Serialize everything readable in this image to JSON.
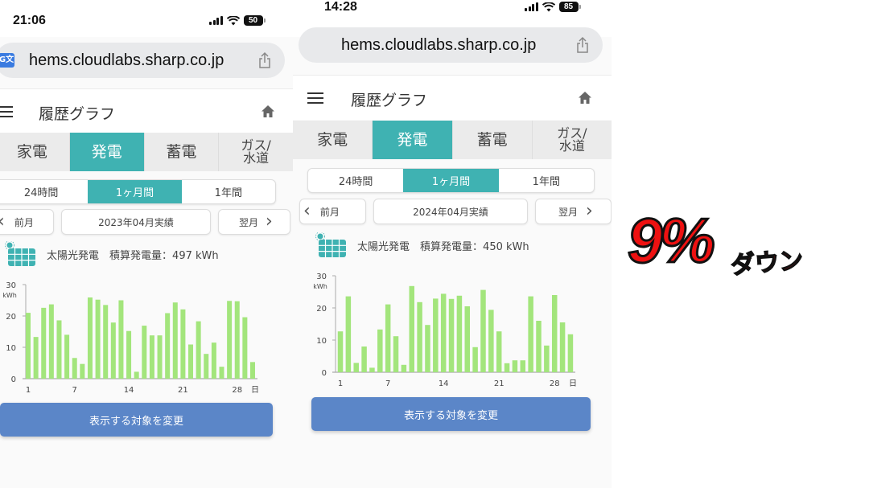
{
  "phones": [
    {
      "status": {
        "time": "21:06",
        "battery": "50"
      },
      "browser": {
        "url": "hems.cloudlabs.sharp.co.jp",
        "translate_icon": "translate-icon",
        "share_icon": "share-icon"
      },
      "header": {
        "title": "履歴グラフ",
        "menu_icon": "hamburger-icon",
        "home_icon": "home-icon"
      },
      "category_tabs": [
        {
          "label": "家電",
          "active": false
        },
        {
          "label": "発電",
          "active": true
        },
        {
          "label": "蓄電",
          "active": false
        },
        {
          "label": "ガス/\n水道",
          "active": false
        }
      ],
      "period_tabs": [
        {
          "label": "24時間",
          "active": false
        },
        {
          "label": "1ヶ月間",
          "active": true
        },
        {
          "label": "1年間",
          "active": false
        }
      ],
      "month_nav": {
        "prev": "前月",
        "current": "2023年04月実績",
        "next": "翌月"
      },
      "summary": {
        "label": "太陽光発電",
        "total_label": "積算発電量：",
        "total": "497 kWh"
      },
      "button": {
        "label": "表示する対象を変更"
      }
    },
    {
      "status": {
        "time": "14:28",
        "battery": "85"
      },
      "browser": {
        "url": "hems.cloudlabs.sharp.co.jp",
        "share_icon": "share-icon"
      },
      "header": {
        "title": "履歴グラフ",
        "menu_icon": "hamburger-icon",
        "home_icon": "home-icon"
      },
      "category_tabs": [
        {
          "label": "家電",
          "active": false
        },
        {
          "label": "発電",
          "active": true
        },
        {
          "label": "蓄電",
          "active": false
        },
        {
          "label": "ガス/\n水道",
          "active": false
        }
      ],
      "period_tabs": [
        {
          "label": "24時間",
          "active": false
        },
        {
          "label": "1ヶ月間",
          "active": true
        },
        {
          "label": "1年間",
          "active": false
        }
      ],
      "month_nav": {
        "prev": "前月",
        "current": "2024年04月実績",
        "next": "翌月"
      },
      "summary": {
        "label": "太陽光発電",
        "total_label": "積算発電量：",
        "total": "450 kWh"
      },
      "button": {
        "label": "表示する対象を変更"
      }
    }
  ],
  "badge": {
    "big": "9%",
    "small": "ダウン"
  },
  "colors": {
    "accent": "#3fb2b2",
    "bar": "#a3e57c",
    "button": "#5b86c8",
    "badge_red": "#ee1111"
  },
  "chart_data": [
    {
      "type": "bar",
      "title": "2023年04月 太陽光発電",
      "xlabel": "日",
      "ylabel": "kWh",
      "ylim": [
        0,
        30
      ],
      "yticks": [
        0,
        10,
        20,
        30
      ],
      "xticks": [
        1,
        7,
        14,
        21,
        28
      ],
      "x": [
        1,
        2,
        3,
        4,
        5,
        6,
        7,
        8,
        9,
        10,
        11,
        12,
        13,
        14,
        15,
        16,
        17,
        18,
        19,
        20,
        21,
        22,
        23,
        24,
        25,
        26,
        27,
        28,
        29,
        30
      ],
      "values": [
        21.0,
        13.3,
        22.6,
        23.7,
        18.6,
        14.0,
        6.6,
        4.7,
        25.9,
        25.2,
        23.5,
        17.9,
        25.0,
        15.2,
        2.2,
        16.9,
        13.8,
        13.8,
        20.9,
        24.3,
        22.1,
        10.9,
        18.3,
        7.9,
        11.5,
        3.8,
        24.8,
        24.7,
        19.6,
        5.3
      ],
      "grid": false
    },
    {
      "type": "bar",
      "title": "2024年04月 太陽光発電",
      "xlabel": "日",
      "ylabel": "kWh",
      "ylim": [
        0,
        30
      ],
      "yticks": [
        0,
        10,
        20,
        30
      ],
      "xticks": [
        1,
        7,
        14,
        21,
        28
      ],
      "x": [
        1,
        2,
        3,
        4,
        5,
        6,
        7,
        8,
        9,
        10,
        11,
        12,
        13,
        14,
        15,
        16,
        17,
        18,
        19,
        20,
        21,
        22,
        23,
        24,
        25,
        26,
        27,
        28,
        29,
        30
      ],
      "values": [
        12.7,
        23.6,
        2.9,
        8.0,
        1.4,
        13.3,
        21.1,
        11.2,
        2.3,
        26.8,
        21.8,
        14.7,
        22.9,
        24.4,
        22.8,
        23.8,
        20.5,
        7.8,
        25.6,
        19.4,
        12.7,
        2.8,
        3.7,
        3.7,
        23.6,
        16.0,
        8.3,
        24.0,
        15.5,
        11.8
      ],
      "grid": false
    }
  ]
}
